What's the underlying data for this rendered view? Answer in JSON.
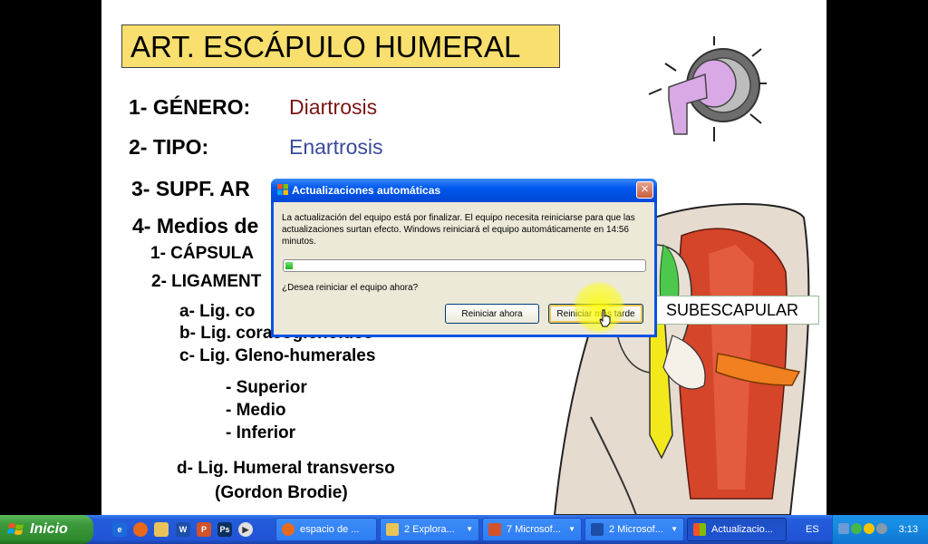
{
  "slide": {
    "title": "ART. ESCÁPULO HUMERAL",
    "item1_label": "1- GÉNERO:",
    "item1_value": "Diartrosis",
    "item1_color": "#7a1515",
    "item2_label": "2- TIPO:",
    "item2_value": "Enartrosis",
    "item2_color": "#3a4a9c",
    "item3_label": "3- SUPF. AR",
    "item4_label": "4- Medios de",
    "sub1": "1- CÁPSULA",
    "sub2": "2- LIGAMENT",
    "lig_a": "a- Lig. co",
    "lig_b": "b- Lig. coracoglenoideo",
    "lig_c": "c- Lig. Gleno-humerales",
    "superior": "- Superior",
    "medio": "- Medio",
    "inferior": "- Inferior",
    "lig_d": "d- Lig. Humeral transverso",
    "gordon": "(Gordon Brodie)",
    "subescapular_label": "SUBESCAPULAR"
  },
  "dialog": {
    "title": "Actualizaciones automáticas",
    "message": "La actualización del equipo está por finalizar. El equipo necesita reiniciarse para que las actualizaciones surtan efecto. Windows reiniciará el equipo automáticamente en 14:56 minutos.",
    "progress": 0.02,
    "question": "¿Desea reiniciar el equipo ahora?",
    "restart_now_label": "Reiniciar ahora",
    "restart_later_label": "Reiniciar más tarde",
    "close_glyph": "×"
  },
  "taskbar": {
    "start_label": "Inicio",
    "quick_launch": [
      "ie-icon",
      "firefox-icon",
      "folder-icon",
      "word-icon",
      "powerpoint-icon",
      "photoshop-icon",
      "media-player-icon"
    ],
    "tasks": [
      {
        "label": "espacio de ...",
        "icon": "firefox-icon",
        "arrow": ""
      },
      {
        "label": "2 Explora...",
        "icon": "folder-icon",
        "arrow": "▼"
      },
      {
        "label": "7 Microsof...",
        "icon": "powerpoint-icon",
        "arrow": "▼"
      },
      {
        "label": "2 Microsof...",
        "icon": "word-icon",
        "arrow": "▼"
      },
      {
        "label": "Actualizacio...",
        "icon": "windows-update-icon",
        "arrow": ""
      }
    ],
    "language": "ES",
    "clock": "3:13"
  }
}
